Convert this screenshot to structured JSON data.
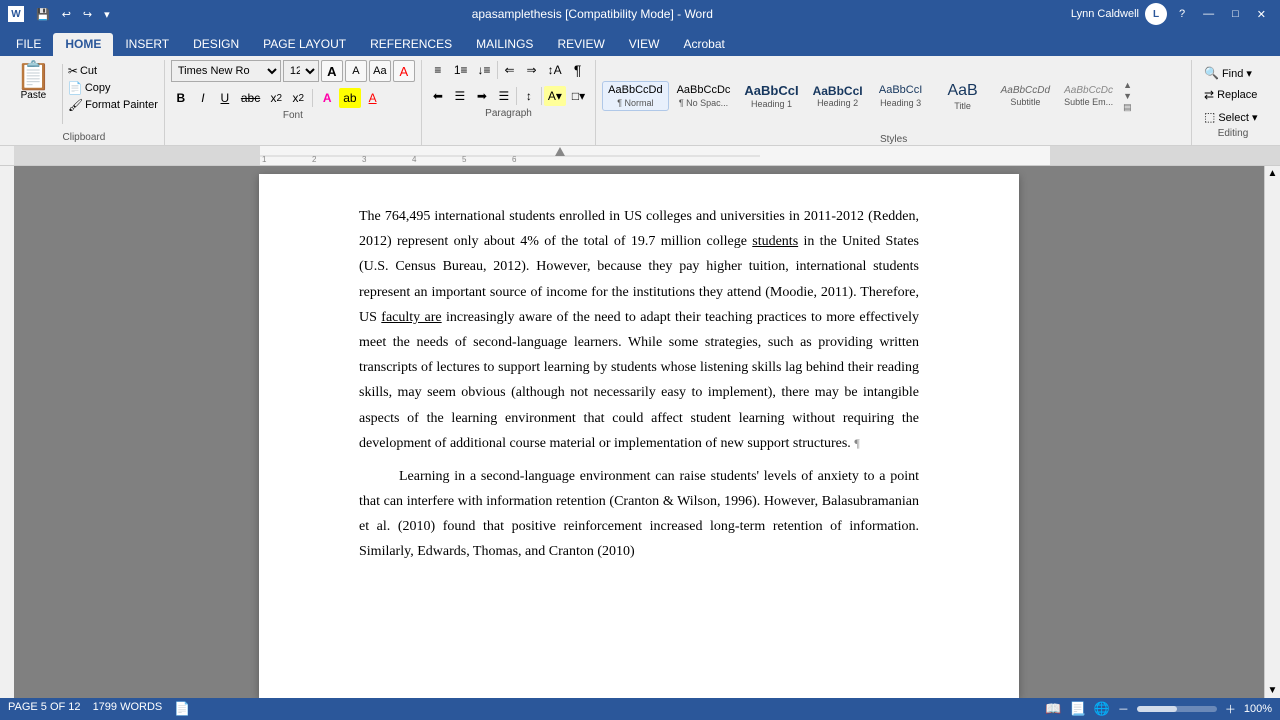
{
  "titlebar": {
    "title": "apasamplethesis [Compatibility Mode] - Word",
    "app": "Word",
    "user": "Lynn Caldwell"
  },
  "quickaccess": {
    "save": "💾",
    "undo": "↩",
    "redo": "↪"
  },
  "tabs": [
    {
      "id": "file",
      "label": "FILE"
    },
    {
      "id": "home",
      "label": "HOME",
      "active": true
    },
    {
      "id": "insert",
      "label": "INSERT"
    },
    {
      "id": "design",
      "label": "DESIGN"
    },
    {
      "id": "pagelayout",
      "label": "PAGE LAYOUT"
    },
    {
      "id": "references",
      "label": "REFERENCES"
    },
    {
      "id": "mailings",
      "label": "MAILINGS"
    },
    {
      "id": "review",
      "label": "REVIEW"
    },
    {
      "id": "view",
      "label": "VIEW"
    },
    {
      "id": "acrobat",
      "label": "Acrobat"
    }
  ],
  "ribbon": {
    "clipboard": {
      "label": "Clipboard",
      "paste_label": "Paste",
      "copy_label": "Copy",
      "cut_label": "Cut",
      "format_painter_label": "Format Painter"
    },
    "font": {
      "label": "Font",
      "font_name": "Times New Ro",
      "font_size": "12",
      "bold": "B",
      "italic": "I",
      "underline": "U",
      "strikethrough": "abc",
      "subscript": "x₂",
      "superscript": "x²",
      "font_color": "A",
      "highlight": "ab",
      "change_case": "Aa",
      "clear_formatting": "A"
    },
    "paragraph": {
      "label": "Paragraph",
      "bullets": "≡",
      "numbering": "≡",
      "multilevel": "≡",
      "decrease_indent": "⇐",
      "increase_indent": "⇒",
      "sort": "↕",
      "show_marks": "¶",
      "align_left": "≡",
      "center": "≡",
      "align_right": "≡",
      "justify": "≡",
      "line_spacing": "↕",
      "shading": "A",
      "borders": "□"
    },
    "styles": {
      "label": "Styles",
      "items": [
        {
          "id": "normal",
          "preview": "AaBbCcDd",
          "label": "¶ Normal"
        },
        {
          "id": "nospace",
          "preview": "AaBbCcDc",
          "label": "¶ No Spac..."
        },
        {
          "id": "heading1",
          "preview": "AaBbCcI",
          "label": "Heading 1"
        },
        {
          "id": "heading2",
          "preview": "AaBbCcI",
          "label": "Heading 2"
        },
        {
          "id": "heading3",
          "preview": "AaBbCcI",
          "label": "Heading 3"
        },
        {
          "id": "title",
          "preview": "AaB",
          "label": "Title"
        },
        {
          "id": "subtitle",
          "preview": "AaBbCcDd",
          "label": "Subtitle"
        },
        {
          "id": "subtleemphasis",
          "preview": "AaBbCcDc",
          "label": "Subtle Em..."
        }
      ]
    },
    "editing": {
      "label": "Editing",
      "find": "Find ▾",
      "replace": "Replace",
      "select": "Select ▾"
    }
  },
  "document": {
    "paragraphs": [
      {
        "id": "p1",
        "indent": false,
        "text": "The 764,495 international students enrolled in US colleges and universities in 2011-2012 (Redden, 2012) represent only about 4% of the total of 19.7 million college students in the United States (U.S. Census Bureau, 2012). However, because they pay higher tuition, international students represent an important source of income for the institutions they attend (Moodie, 2011). Therefore, US faculty are increasingly aware of the need to adapt their teaching practices to more effectively meet the needs of second-language learners. While some strategies, such as providing written transcripts of lectures to support learning by students whose listening skills lag behind their reading skills, may seem obvious (although not necessarily easy to implement), there may be intangible aspects of the learning environment that could affect student learning without requiring the development of additional course material or implementation of new support structures. ¶",
        "underlined_words": [
          "faculty are"
        ]
      },
      {
        "id": "p2",
        "indent": true,
        "text": "Learning in a second-language environment can raise students' levels of anxiety to a point that can interfere with information retention (Cranton & Wilson, 1996). However, Balasubramanian et al. (2010) found that positive reinforcement increased long-term retention of information. Similarly, Edwards, Thomas, and Cranton (2010)"
      }
    ]
  },
  "statusbar": {
    "page_info": "PAGE 5 OF 12",
    "word_count": "1799 WORDS",
    "zoom_level": "100%"
  }
}
